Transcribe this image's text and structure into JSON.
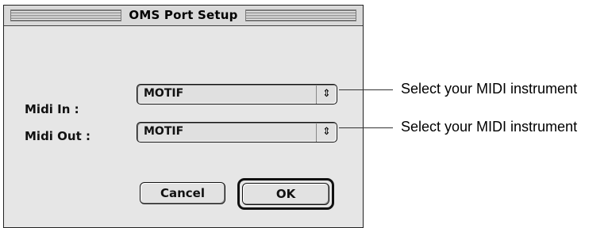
{
  "window": {
    "title": "OMS Port Setup"
  },
  "midi_in": {
    "label": "Midi In :",
    "value": "MOTIF",
    "icon": "up-down-arrows-icon"
  },
  "midi_out": {
    "label": "Midi Out :",
    "value": "MOTIF",
    "icon": "up-down-arrows-icon"
  },
  "buttons": {
    "cancel": "Cancel",
    "ok": "OK"
  },
  "annotations": {
    "midi_in_note": "Select your MIDI instrument",
    "midi_out_note": "Select your MIDI instrument"
  }
}
